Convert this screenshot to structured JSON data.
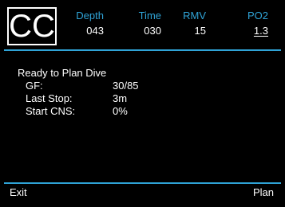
{
  "header": {
    "mode": "CC",
    "columns": [
      {
        "label": "Depth",
        "value": "043"
      },
      {
        "label": "Time",
        "value": "030"
      },
      {
        "label": "RMV",
        "value": "15"
      },
      {
        "label": "PO2",
        "value": "1.3"
      }
    ]
  },
  "planner": {
    "title": "Ready to Plan Dive",
    "rows": [
      {
        "label": "GF:",
        "value": "30/85"
      },
      {
        "label": "Last Stop:",
        "value": "3m"
      },
      {
        "label": "Start CNS:",
        "value": "0%"
      }
    ]
  },
  "softkeys": {
    "left": "Exit",
    "right": "Plan"
  },
  "colors": {
    "accent": "#2fa3d6",
    "text": "#ffffff",
    "background": "#000000"
  }
}
